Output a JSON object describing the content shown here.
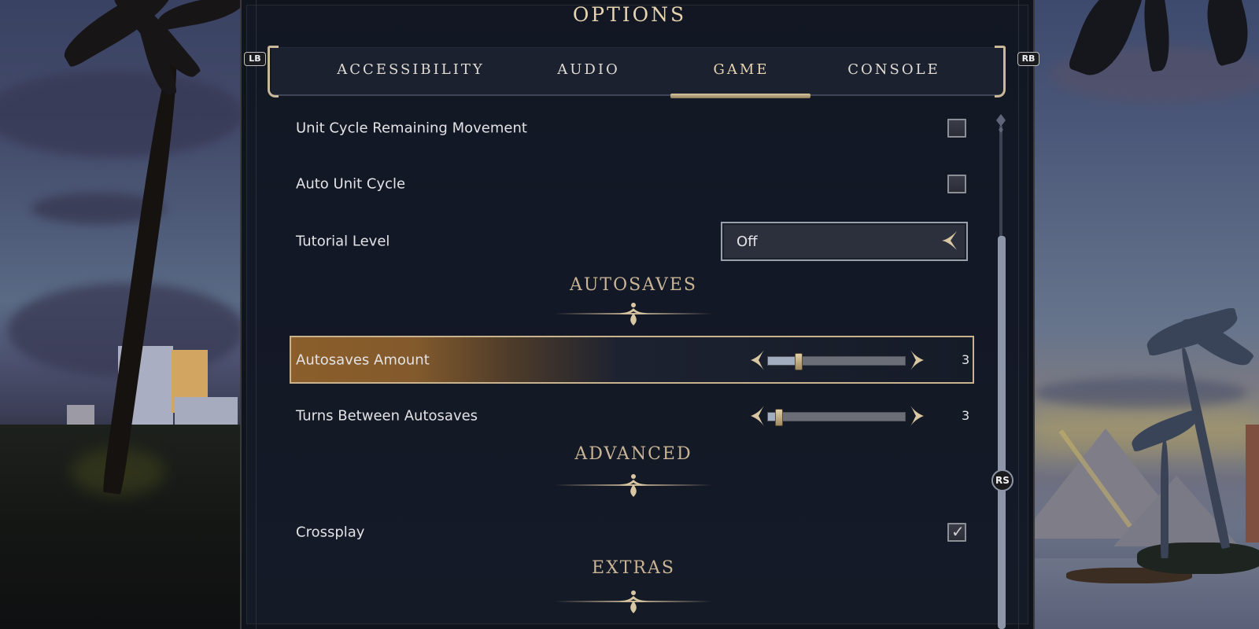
{
  "window": {
    "title": "OPTIONS"
  },
  "controller_hints": {
    "left_bumper": "LB",
    "right_bumper": "RB",
    "right_stick": "RS"
  },
  "tabs": [
    {
      "label": "ACCESSIBILITY",
      "active": false
    },
    {
      "label": "AUDIO",
      "active": false
    },
    {
      "label": "GAME",
      "active": true
    },
    {
      "label": "CONSOLE",
      "active": false
    }
  ],
  "settings": {
    "unit_cycle_remaining_movement": {
      "label": "Unit Cycle Remaining Movement",
      "checked": false
    },
    "auto_unit_cycle": {
      "label": "Auto Unit Cycle",
      "checked": false
    },
    "tutorial_level": {
      "label": "Tutorial Level",
      "value": "Off"
    }
  },
  "sections": {
    "autosaves": {
      "title": "AUTOSAVES",
      "autosaves_amount": {
        "label": "Autosaves Amount",
        "value": "3",
        "fraction": 0.22,
        "focused": true
      },
      "turns_between_autosaves": {
        "label": "Turns Between Autosaves",
        "value": "3",
        "fraction": 0.08
      }
    },
    "advanced": {
      "title": "ADVANCED",
      "crossplay": {
        "label": "Crossplay",
        "checked": true
      }
    },
    "extras": {
      "title": "EXTRAS"
    }
  },
  "scroll": {
    "position_fraction": 0.22
  },
  "colors": {
    "accent_gold": "#c9b596",
    "panel_bg": "#131826",
    "highlight_amber": "#8b5e2a",
    "text": "#e3e3e6"
  }
}
